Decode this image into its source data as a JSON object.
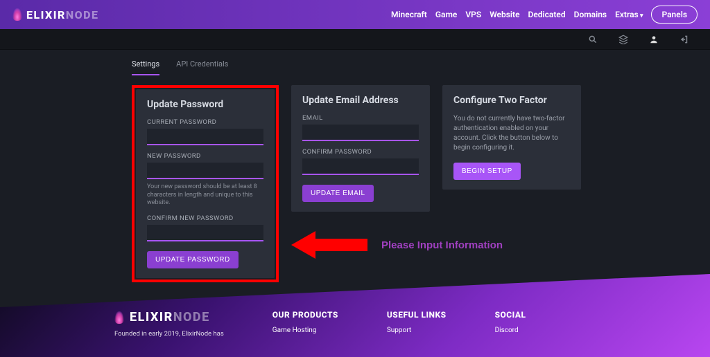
{
  "brand": {
    "main": "ELIXIR",
    "dim": "NODE"
  },
  "nav": {
    "items": [
      "Minecraft",
      "Game",
      "VPS",
      "Website",
      "Dedicated",
      "Domains",
      "Extras"
    ],
    "panels": "Panels"
  },
  "tabs": {
    "settings": "Settings",
    "api": "API Credentials"
  },
  "password_card": {
    "title": "Update Password",
    "current_label": "CURRENT PASSWORD",
    "new_label": "NEW PASSWORD",
    "hint": "Your new password should be at least 8 characters in length and unique to this website.",
    "confirm_label": "CONFIRM NEW PASSWORD",
    "button": "UPDATE PASSWORD"
  },
  "email_card": {
    "title": "Update Email Address",
    "email_label": "EMAIL",
    "confirm_label": "CONFIRM PASSWORD",
    "button": "UPDATE EMAIL"
  },
  "twofactor_card": {
    "title": "Configure Two Factor",
    "desc": "You do not currently have two-factor authentication enabled on your account. Click the button below to begin configuring it.",
    "button": "BEGIN SETUP"
  },
  "annotation": {
    "text": "Please Input Information"
  },
  "footer": {
    "brand_desc": "Founded in early 2019, ElixirNode has",
    "products_title": "OUR PRODUCTS",
    "products_first": "Game Hosting",
    "links_title": "USEFUL LINKS",
    "links_first": "Support",
    "social_title": "SOCIAL",
    "social_first": "Discord"
  }
}
